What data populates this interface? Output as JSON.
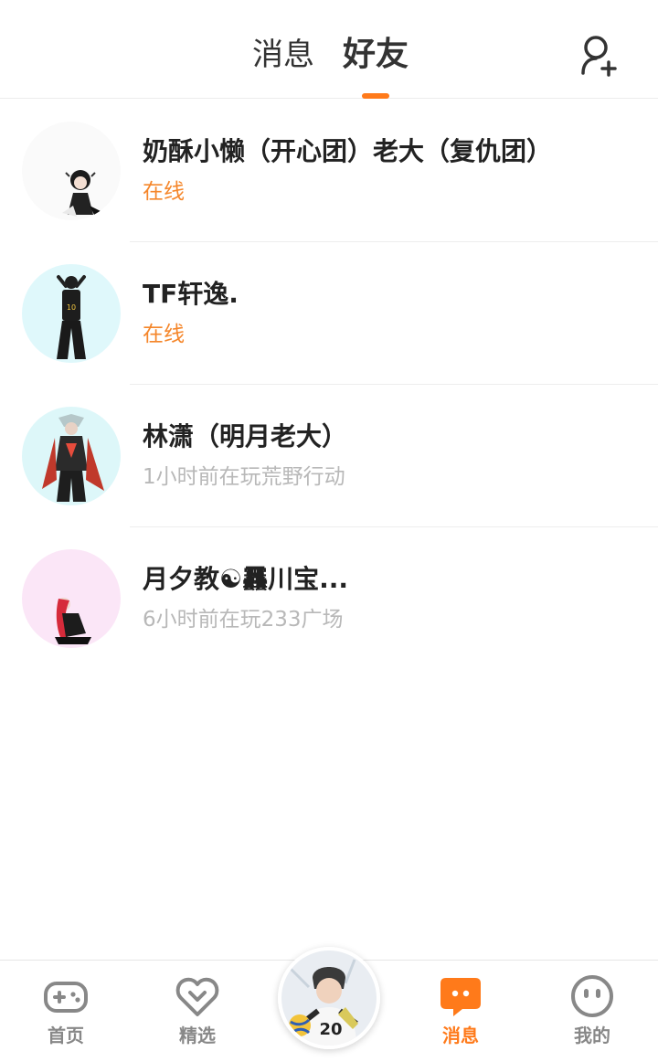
{
  "header": {
    "tabs": [
      {
        "label": "消息",
        "active": false
      },
      {
        "label": "好友",
        "active": true
      }
    ],
    "add_friend_icon": "person-add-icon",
    "accent_color": "#ff7a1a"
  },
  "friends": [
    {
      "name": "奶酥小懒（开心团）老大（复仇团）",
      "status": "在线",
      "online": true
    },
    {
      "name": "TF轩逸.⁣",
      "status": "在线",
      "online": true
    },
    {
      "name": "林潇（明月老大）",
      "status": "1小时前在玩荒野行动",
      "online": false
    },
    {
      "name": "月夕教☯︎䨺川宝...",
      "status": "6小时前在玩233广场",
      "online": false
    }
  ],
  "bottom_nav": {
    "items": [
      {
        "label": "首页",
        "icon": "gamepad-icon",
        "active": false
      },
      {
        "label": "精选",
        "icon": "heart-badge-icon",
        "active": false
      },
      {
        "label": "",
        "icon": "center-avatar",
        "active": false
      },
      {
        "label": "消息",
        "icon": "chat-bubble-icon",
        "active": true
      },
      {
        "label": "我的",
        "icon": "face-icon",
        "active": false
      }
    ]
  }
}
